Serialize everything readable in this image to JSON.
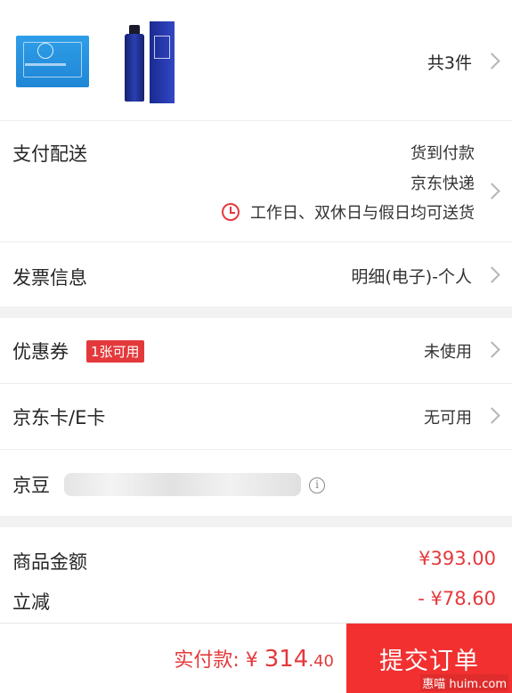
{
  "products": {
    "count_text": "共3件"
  },
  "payment": {
    "label": "支付配送",
    "method": "货到付款",
    "courier": "京东快递",
    "delivery_note": "工作日、双休日与假日均可送货"
  },
  "invoice": {
    "label": "发票信息",
    "value": "明细(电子)-个人"
  },
  "coupon": {
    "label": "优惠券",
    "badge": "1张可用",
    "value": "未使用"
  },
  "jd_card": {
    "label": "京东卡/E卡",
    "value": "无可用"
  },
  "jd_beans": {
    "label": "京豆",
    "info_glyph": "i"
  },
  "amounts": {
    "goods_label": "商品金额",
    "goods_value": "¥393.00",
    "discount_label": "立减",
    "discount_value": "- ¥78.60"
  },
  "footer": {
    "pay_label": "实付款: ¥ ",
    "pay_int": "314",
    "pay_dec": ".40",
    "submit_label": "提交订单",
    "watermark": "惠喵 huim.com"
  },
  "colors": {
    "accent": "#e4393c",
    "button": "#f23030"
  }
}
